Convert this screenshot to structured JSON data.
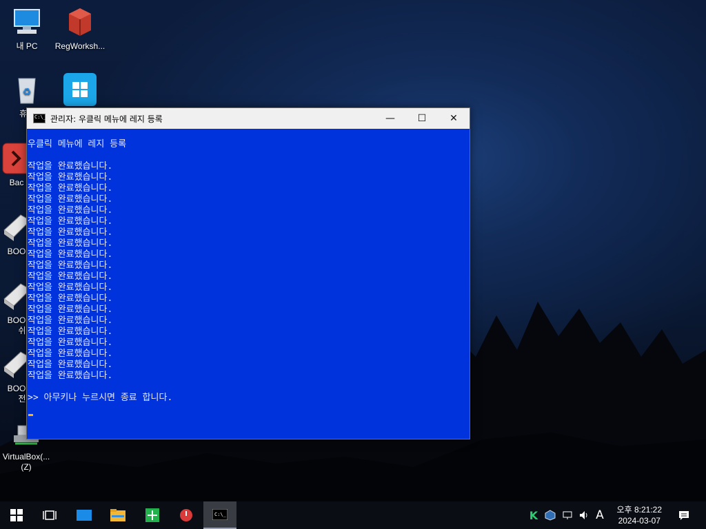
{
  "desktop_icons": [
    {
      "label": "내 PC",
      "icon": "computer-icon"
    },
    {
      "label": "RegWorksh...",
      "icon": "regworkshop-icon"
    },
    {
      "label": "휴지",
      "icon": "recycle-bin-icon"
    },
    {
      "label": "",
      "icon": "windows-tile-icon"
    },
    {
      "label": "Bac",
      "icon": "backup-icon"
    },
    {
      "label": "BOO",
      "icon": "boot-tool-icon"
    },
    {
      "label": "BOO",
      "icon": "boot-tool-icon",
      "label2": "쉬"
    },
    {
      "label": "BOO",
      "icon": "boot-tool-icon",
      "label2": "전"
    },
    {
      "label": "VirtualBox(...",
      "icon": "network-drive-icon",
      "label2": "(Z)"
    }
  ],
  "window": {
    "title": "관리자:  우클릭 메뉴에 레지 등록",
    "minimize": "—",
    "maximize": "☐",
    "close": "✕"
  },
  "console": {
    "heading": "우클릭 메뉴에 레지 등록",
    "lines": [
      "작업을 완료했습니다.",
      "작업을 완료했습니다.",
      "작업을 완료했습니다.",
      "작업을 완료했습니다.",
      "작업을 완료했습니다.",
      "작업을 완료했습니다.",
      "작업을 완료했습니다.",
      "작업을 완료했습니다.",
      "작업을 완료했습니다.",
      "작업을 완료했습니다.",
      "작업을 완료했습니다.",
      "작업을 완료했습니다.",
      "작업을 완료했습니다.",
      "작업을 완료했습니다.",
      "작업을 완료했습니다.",
      "작업을 완료했습니다.",
      "작업을 완료했습니다.",
      "작업을 완료했습니다.",
      "작업을 완료했습니다.",
      "작업을 완료했습니다."
    ],
    "prompt": ">> 아무키나 누르시면 종료 합니다."
  },
  "taskbar": {
    "items": [
      "start-icon",
      "task-view-icon",
      "desktop-icon",
      "file-explorer-icon",
      "spreadsheet-icon",
      "shutdown-icon",
      "console-icon"
    ],
    "ime": "A",
    "time": "오후 8:21:22",
    "date": "2024-03-07"
  },
  "colors": {
    "console_bg": "#0033db",
    "console_text": "#e8e8ff",
    "cursor": "#ffb400"
  }
}
